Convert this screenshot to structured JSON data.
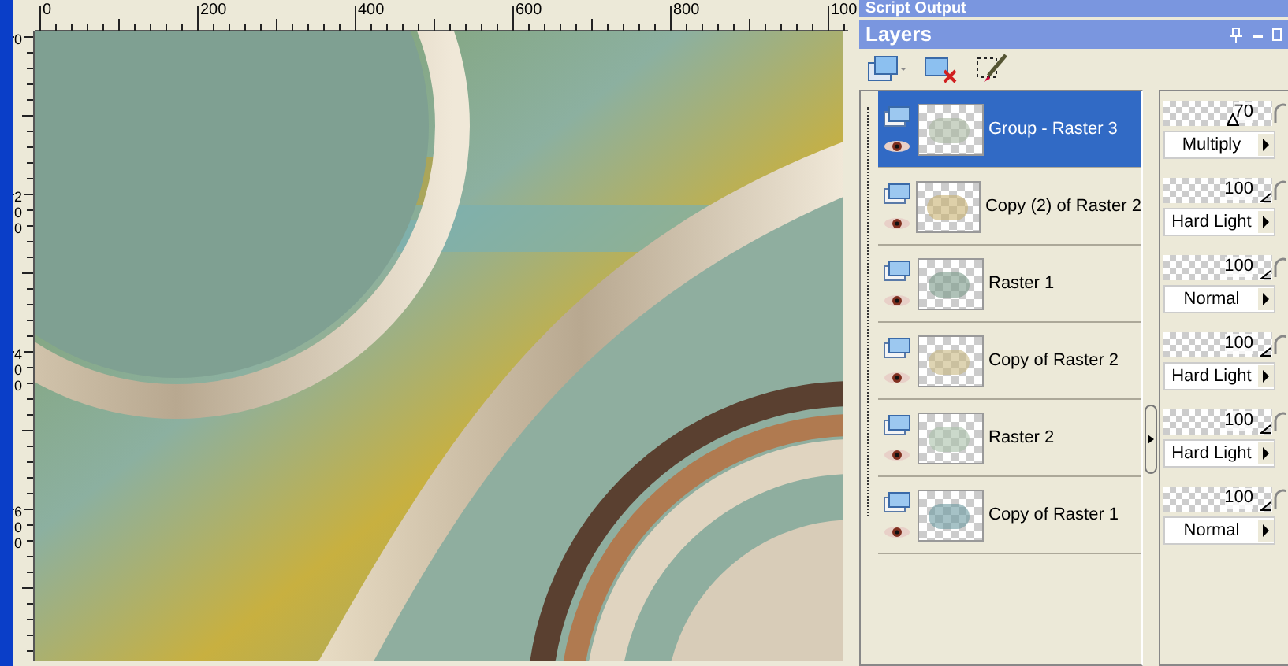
{
  "ruler_top": {
    "labels": [
      "0",
      "200",
      "400",
      "600",
      "800",
      "100"
    ]
  },
  "ruler_left": {
    "labels": [
      "0",
      "200",
      "400",
      "600"
    ]
  },
  "script_output": {
    "title": "Script Output"
  },
  "layers_panel": {
    "title": "Layers",
    "layers": [
      {
        "name": "Group - Raster 3",
        "selected": true,
        "opacity": "70",
        "level": 0.7,
        "blend": "Multiply"
      },
      {
        "name": "Copy (2) of Raster 2",
        "selected": false,
        "opacity": "100",
        "level": 1,
        "blend": "Hard Light"
      },
      {
        "name": "Raster 1",
        "selected": false,
        "opacity": "100",
        "level": 1,
        "blend": "Normal"
      },
      {
        "name": "Copy of Raster 2",
        "selected": false,
        "opacity": "100",
        "level": 1,
        "blend": "Hard Light"
      },
      {
        "name": "Raster 2",
        "selected": false,
        "opacity": "100",
        "level": 1,
        "blend": "Hard Light"
      },
      {
        "name": "Copy of Raster 1",
        "selected": false,
        "opacity": "100",
        "level": 1,
        "blend": "Normal"
      }
    ]
  }
}
